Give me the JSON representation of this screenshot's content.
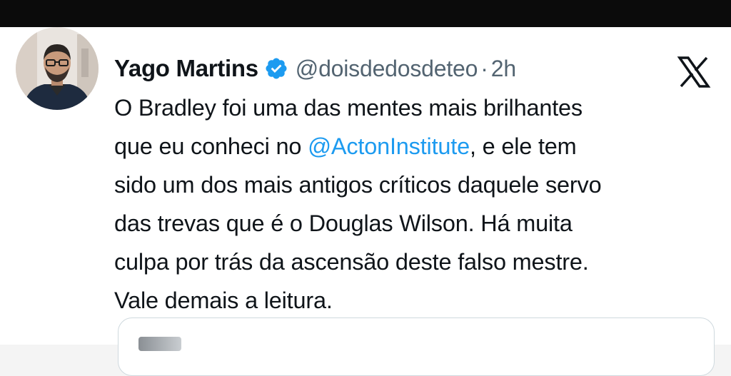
{
  "tweet": {
    "display_name": "Yago Martins",
    "handle": "@doisdedosdeteo",
    "separator": "·",
    "time": "2h",
    "lines": [
      {
        "before": "O Bradley foi uma das mentes mais brilhantes",
        "mention": "",
        "after": ""
      },
      {
        "before": "que eu conheci no ",
        "mention": "@ActonInstitute",
        "after": ", e ele tem"
      },
      {
        "before": "sido um dos mais antigos críticos daquele servo",
        "mention": "",
        "after": ""
      },
      {
        "before": "das trevas que é o Douglas Wilson. Há muita",
        "mention": "",
        "after": ""
      },
      {
        "before": "culpa por trás da ascensão deste falso mestre.",
        "mention": "",
        "after": ""
      },
      {
        "before": "Vale demais a leitura.",
        "mention": "",
        "after": ""
      }
    ]
  },
  "icons": {
    "verified": "verified-badge-icon",
    "platform": "x-logo-icon"
  },
  "colors": {
    "text": "#0f1419",
    "secondary": "#536471",
    "accent": "#1d9bf0",
    "top_bar": "#0b0b0b"
  }
}
